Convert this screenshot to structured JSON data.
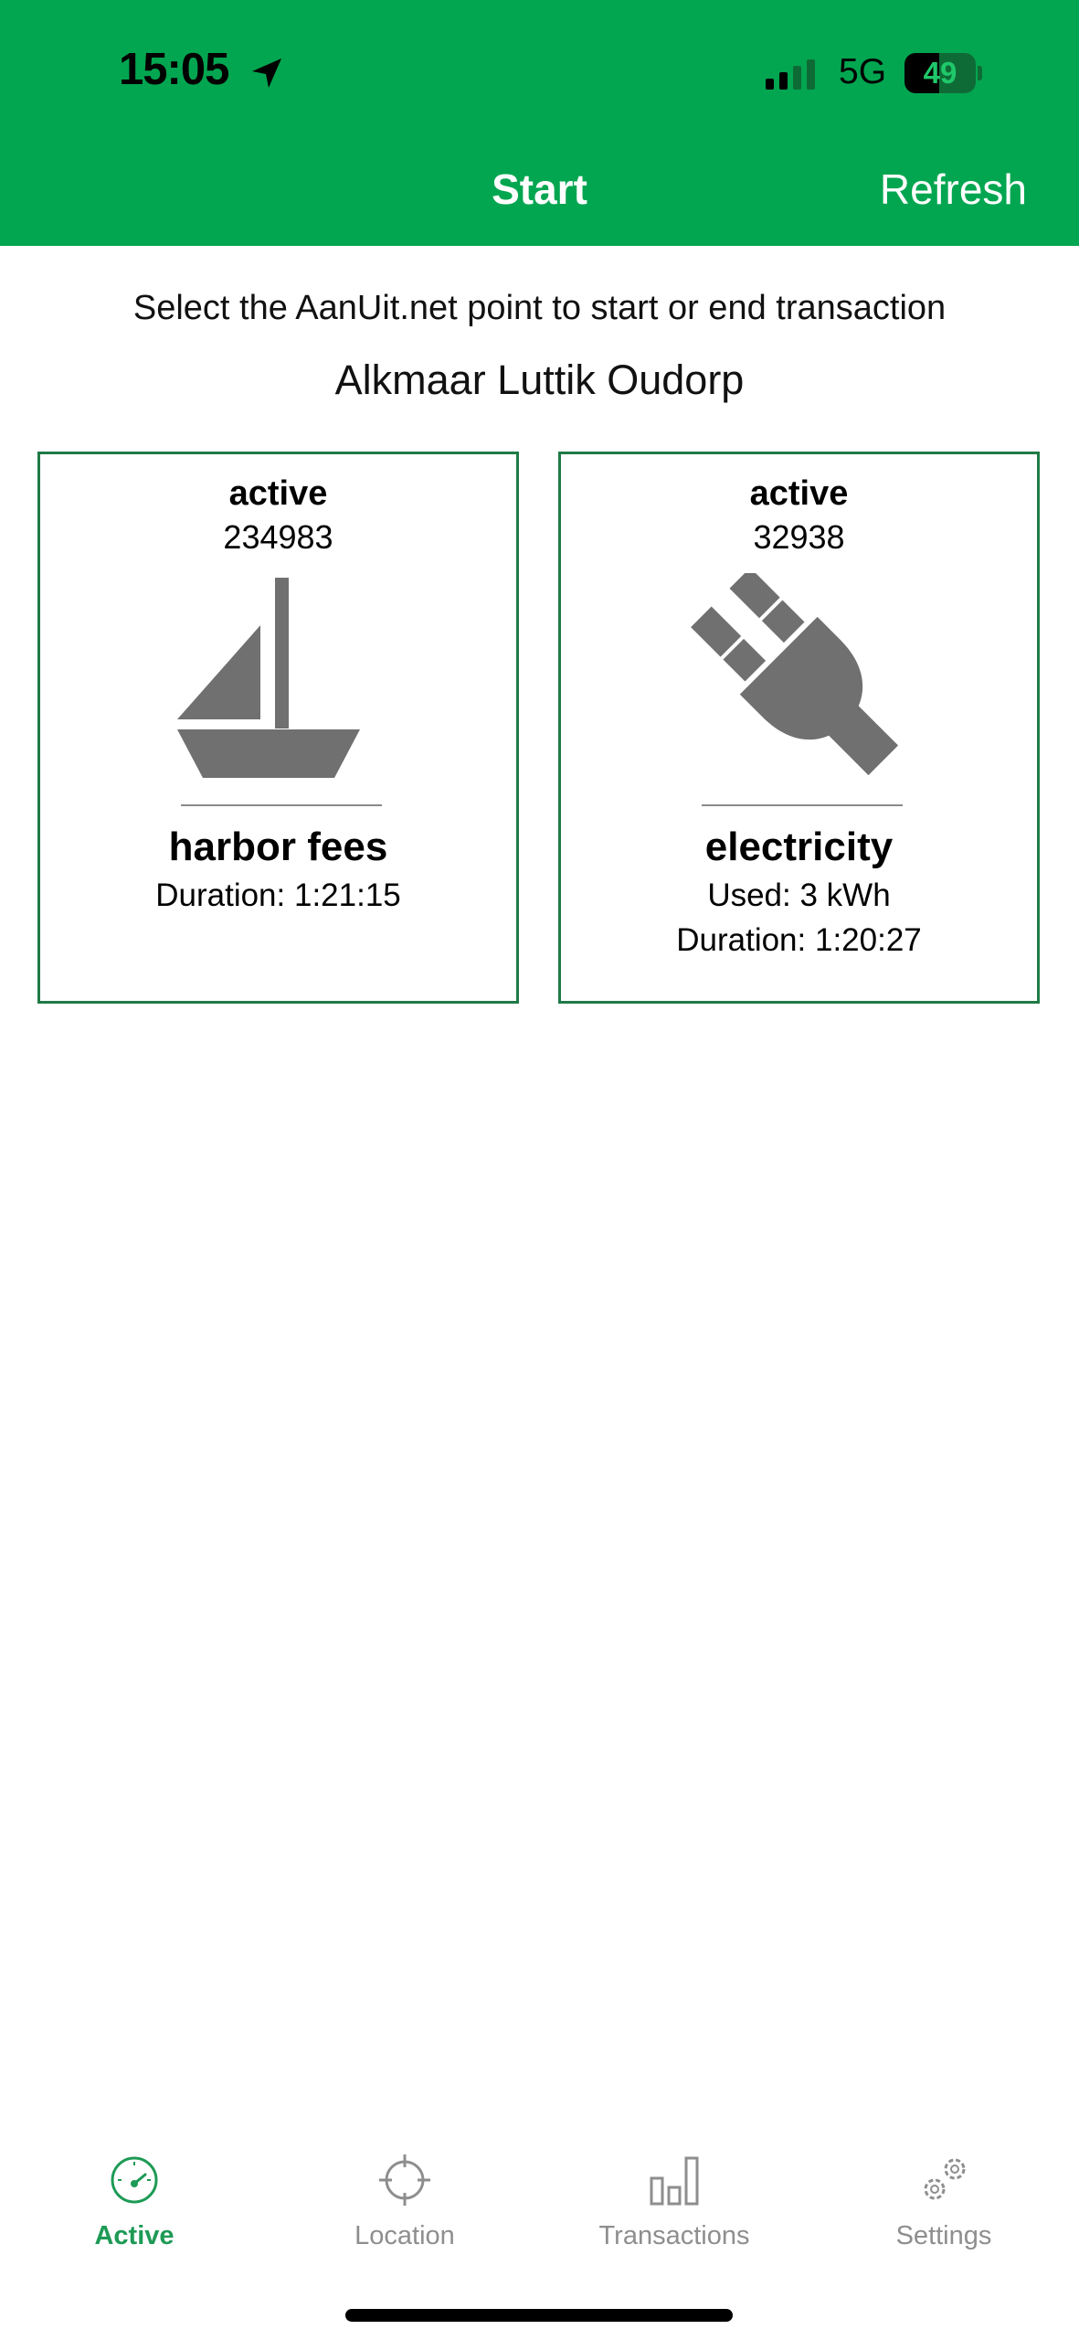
{
  "status_bar": {
    "time": "15:05",
    "network": "5G",
    "battery": "49",
    "battery_level": 0.49
  },
  "header": {
    "title": "Start",
    "refresh_label": "Refresh",
    "background_color": "#02a650"
  },
  "content": {
    "instruction": "Select the AanUit.net point to start or end transaction",
    "location_name": "Alkmaar Luttik Oudorp"
  },
  "cards": [
    {
      "status": "active",
      "id": "234983",
      "icon": "sailboat-icon",
      "name": "harbor fees",
      "line1": "Duration: 1:21:15",
      "line2": ""
    },
    {
      "status": "active",
      "id": "32938",
      "icon": "plug-icon",
      "name": "electricity",
      "line1": "Used: 3 kWh",
      "line2": "Duration: 1:20:27"
    }
  ],
  "tabbar": {
    "items": [
      {
        "label": "Active",
        "icon": "speedometer-icon",
        "active": true
      },
      {
        "label": "Location",
        "icon": "crosshair-icon",
        "active": false
      },
      {
        "label": "Transactions",
        "icon": "bar-chart-icon",
        "active": false
      },
      {
        "label": "Settings",
        "icon": "gears-icon",
        "active": false
      }
    ],
    "active_color": "#1d9a55",
    "inactive_color": "#8e8e8e"
  },
  "card_border_color": "#1f7a46"
}
